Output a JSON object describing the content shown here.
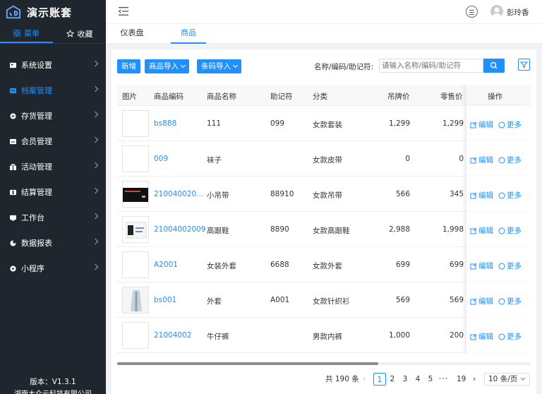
{
  "app": {
    "title": "演示账套"
  },
  "sidebar": {
    "tabs": [
      {
        "label": "菜单"
      },
      {
        "label": "收藏"
      }
    ],
    "items": [
      {
        "label": "系统设置"
      },
      {
        "label": "档案管理"
      },
      {
        "label": "存货管理"
      },
      {
        "label": "会员管理"
      },
      {
        "label": "活动管理"
      },
      {
        "label": "结算管理"
      },
      {
        "label": "工作台"
      },
      {
        "label": "数据报表"
      },
      {
        "label": "小程序"
      }
    ],
    "version": "版本：V1.3.1",
    "company": "湖南大众云科技有限公司"
  },
  "header": {
    "user": "彭玲香"
  },
  "page_tabs": [
    {
      "label": "仪表盘"
    },
    {
      "label": "商品"
    }
  ],
  "toolbar": {
    "add": "新增",
    "import_goods": "商品导入",
    "import_barcode": "条码导入",
    "search_label": "名称/编码/助记符:",
    "search_placeholder": "请输入名称/编码/助记符"
  },
  "table": {
    "columns": [
      "图片",
      "商品编码",
      "商品名称",
      "助记符",
      "分类",
      "吊牌价",
      "零售价",
      "操作"
    ],
    "edit_label": "编辑",
    "more_label": "更多",
    "rows": [
      {
        "code": "bs888",
        "name": "111",
        "mnemonic": "099",
        "category": "女款套装",
        "tag_price": "1,299",
        "retail_price": "1,299",
        "img": "none"
      },
      {
        "code": "009",
        "name": "袜子",
        "mnemonic": "",
        "category": "女款皮带",
        "tag_price": "0",
        "retail_price": "0",
        "img": "none"
      },
      {
        "code": "210040020...",
        "name": "小吊带",
        "mnemonic": "88910",
        "category": "女款吊带",
        "tag_price": "566",
        "retail_price": "345",
        "img": "dark"
      },
      {
        "code": "21004002009",
        "name": "高跟鞋",
        "mnemonic": "8890",
        "category": "女款高跟鞋",
        "tag_price": "2,988",
        "retail_price": "1,998",
        "img": "doc"
      },
      {
        "code": "A2001",
        "name": "女装外套",
        "mnemonic": "6688",
        "category": "女款外套",
        "tag_price": "699",
        "retail_price": "699",
        "img": "none"
      },
      {
        "code": "bs001",
        "name": "外套",
        "mnemonic": "A001",
        "category": "女款针织衫",
        "tag_price": "569",
        "retail_price": "569",
        "img": "coat"
      },
      {
        "code": "21004002",
        "name": "牛仔裤",
        "mnemonic": "",
        "category": "男款内裤",
        "tag_price": "1,000",
        "retail_price": "200",
        "img": "none"
      }
    ]
  },
  "pagination": {
    "total": "共 190 条",
    "pages": [
      "1",
      "2",
      "3",
      "4",
      "5"
    ],
    "ellipsis": "•••",
    "last": "19",
    "current": "1",
    "page_size": "10 条/页"
  }
}
